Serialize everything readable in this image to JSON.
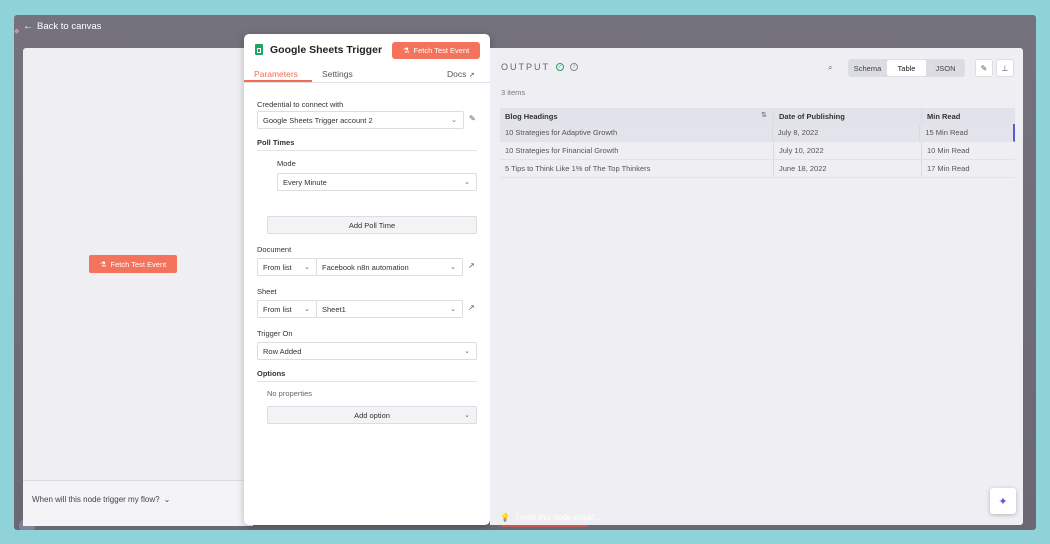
{
  "nav": {
    "back_label": "Back to canvas"
  },
  "canvas": {
    "fetch_button_label": "Fetch Test Event",
    "question_label": "When will this node trigger my flow?"
  },
  "node": {
    "title": "Google Sheets Trigger",
    "fetch_button_label": "Fetch Test Event",
    "tabs": [
      {
        "label": "Parameters"
      },
      {
        "label": "Settings"
      }
    ],
    "docs_label": "Docs"
  },
  "params": {
    "credential_label": "Credential to connect with",
    "credential_value": "Google Sheets Trigger account 2",
    "poll_times_label": "Poll Times",
    "mode_label": "Mode",
    "mode_value": "Every Minute",
    "add_poll_time_label": "Add Poll Time",
    "document_label": "Document",
    "document_source": "From list",
    "document_value": "Facebook n8n automation",
    "sheet_label": "Sheet",
    "sheet_source": "From list",
    "sheet_value": "Sheet1",
    "trigger_on_label": "Trigger On",
    "trigger_on_value": "Row Added",
    "options_label": "Options",
    "no_properties_label": "No properties",
    "add_option_label": "Add option"
  },
  "output": {
    "title": "OUTPUT",
    "items_count": "3 items",
    "views": [
      {
        "label": "Schema"
      },
      {
        "label": "Table"
      },
      {
        "label": "JSON"
      }
    ],
    "active_view": "Table",
    "columns": [
      "Blog Headings",
      "Date of Publishing",
      "Min Read"
    ],
    "rows": [
      [
        "10 Strategies for Adaptive Growth",
        "July 8, 2022",
        "15 Min Read"
      ],
      [
        "10 Strategies for Financial Growth",
        "July 10, 2022",
        "10 Min Read"
      ],
      [
        "5 Tips to Think Like 1% of The Top Thinkers",
        "June 18, 2022",
        "17 Min Read"
      ]
    ]
  },
  "footer": {
    "wish_label": "I wish this node would..."
  },
  "colors": {
    "accent": "#f26b53",
    "button": "#f4735d",
    "selected_row_marker": "#5b58d6",
    "sheets_green": "#1fa463"
  }
}
